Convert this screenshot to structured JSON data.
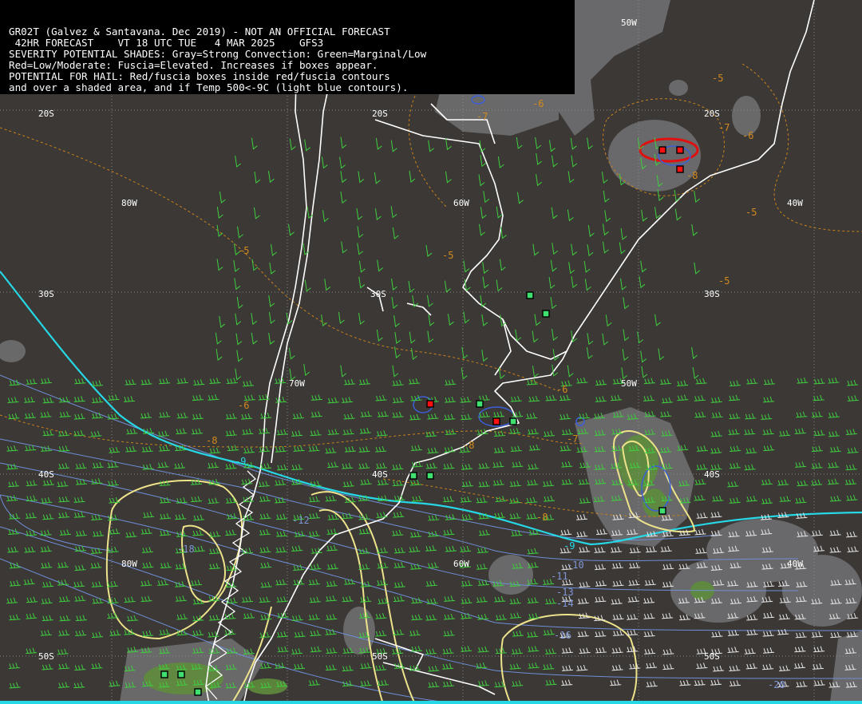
{
  "header": {
    "line1": "GR02T (Galvez & Santavana. Dec 2019) - NOT AN OFFICIAL FORECAST",
    "line2": " 42HR FORECAST    VT 18 UTC TUE   4 MAR 2025    GFS3",
    "line3": "SEVERITY POTENTIAL SHADES: Gray=Strong Convection: Green=Marginal/Low",
    "line4": "Red=Low/Moderate: Fuscia=Elevated. Increases if boxes appear.",
    "line5": "POTENTIAL FOR HAIL: Red/fuscia boxes inside red/fuscia contours",
    "line6": "and over a shaded area, and if Temp 500<-9C (light blue contours)."
  },
  "grid_labels": {
    "lat_20s": "20S",
    "lat_30s": "30S",
    "lat_40s": "40S",
    "lat_50s": "50S",
    "lon_80w": "80W",
    "lon_70w": "70W",
    "lon_60w": "60W",
    "lon_50w": "50W",
    "lon_40w": "40W"
  },
  "temp_labels": {
    "t_neg5": "-5",
    "t_neg6": "-6",
    "t_neg7": "-7",
    "t_neg8": "-8",
    "t_neg9": "-9",
    "t_neg10": "-10",
    "t_neg11": "-11",
    "t_neg12": "-12",
    "t_neg13": "-13",
    "t_neg14": "-14",
    "t_neg16": "-16",
    "t_neg18": "-18",
    "t_neg20": "-20"
  },
  "colors": {
    "background": "#3b3836",
    "coast": "#ffffff",
    "gray_shade": "#6e6e70",
    "green_shade": "#5a8a3c",
    "wind_barbs_green": "#3fcf3f",
    "wind_barbs_white": "#e8e8e8",
    "temp_contour_orange": "#d38a1d",
    "temp_contour_blue": "#6f8fd8",
    "cyan_contour": "#26d7e6",
    "yellow_contour": "#f0e68c",
    "hail_red": "#e01010",
    "marker_green": "#40e070",
    "marker_red": "#ff1010"
  }
}
